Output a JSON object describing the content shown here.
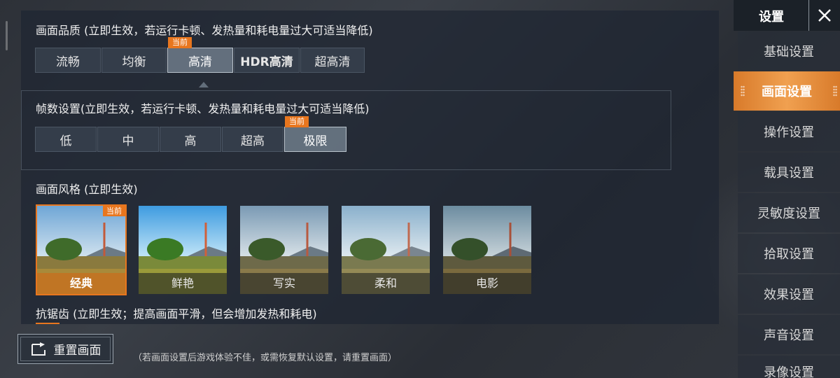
{
  "quality": {
    "title": "画面品质 (立即生效，若运行卡顿、发热量和耗电量过大可适当降低)",
    "options": [
      "流畅",
      "均衡",
      "高清",
      "HDR高清",
      "超高清"
    ],
    "current_badge": "当前"
  },
  "fps": {
    "title": "帧数设置(立即生效，若运行卡顿、发热量和耗电量过大可适当降低)",
    "options": [
      "低",
      "中",
      "高",
      "超高",
      "极限"
    ],
    "current_badge": "当前"
  },
  "style": {
    "title": "画面风格 (立即生效)",
    "options": [
      "经典",
      "鲜艳",
      "写实",
      "柔和",
      "电影"
    ],
    "current_badge": "当前"
  },
  "antialias": {
    "title": "抗锯齿 (立即生效；提高画面平滑，但会增加发热和耗电)"
  },
  "reset": {
    "button_label": "重置画面",
    "note": "（若画面设置后游戏体验不佳，或需恢复默认设置，请重置画面）"
  },
  "sidebar": {
    "title": "设置",
    "items": [
      "基础设置",
      "画面设置",
      "操作设置",
      "载具设置",
      "灵敏度设置",
      "拾取设置",
      "效果设置",
      "声音设置",
      "录像设置"
    ]
  },
  "colors": {
    "accent": "#e8761e",
    "active_tab": "#f0a050"
  },
  "icons": {
    "close": "close-icon",
    "reset": "reset-icon"
  }
}
